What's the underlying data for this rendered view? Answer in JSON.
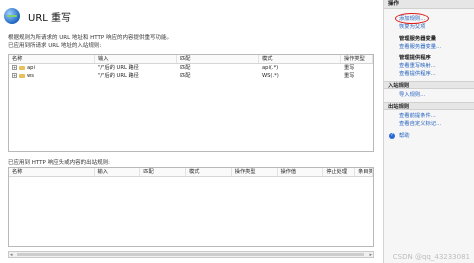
{
  "header": {
    "title": "URL 重写"
  },
  "description": "根据规则为所请求的 URL 地址和 HTTP 响应的内容提供重写功能。",
  "inbound": {
    "label": "已应用到所请求 URL 地址的入站规则:",
    "columns": [
      "名称",
      "输入",
      "匹配",
      "模式",
      "操作类型"
    ],
    "rows": [
      [
        "api",
        "\"/\"后的 URL 路径",
        "匹配",
        "api(.*)",
        "重写"
      ],
      [
        "ws",
        "\"/\"后的 URL 路径",
        "匹配",
        "WS(.*)",
        "重写"
      ]
    ]
  },
  "outbound": {
    "label": "已应用到 HTTP 响应头或内容的出站规则:",
    "columns": [
      "名称",
      "输入",
      "匹配",
      "模式",
      "操作类型",
      "操作值",
      "停止处理",
      "条目类"
    ]
  },
  "actions": {
    "title": "操作",
    "add_rule": "添加规则...",
    "revert": "恢复为父项",
    "server_vars_title": "管理服务器变量",
    "view_server_vars": "查看服务器变量...",
    "providers_title": "管理提供程序",
    "view_rewrite_maps": "查看重写映射...",
    "view_providers": "查看提供程序...",
    "inbound_title": "入站规则",
    "import_rules": "导入规则...",
    "outbound_title": "出站规则",
    "view_preconditions": "查看前提条件...",
    "view_custom_tags": "查看自定义标记...",
    "help": "帮助"
  },
  "watermark": "CSDN @qq_43233081"
}
